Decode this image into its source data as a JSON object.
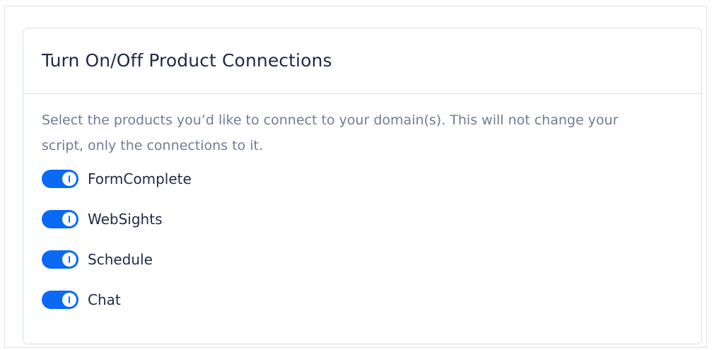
{
  "panel": {
    "title": "Turn On/Off Product Connections",
    "description": "Select the products you’d like to connect to your domain(s). This will not change your script, only the connections to it."
  },
  "products": [
    {
      "label": "FormComplete",
      "enabled": true
    },
    {
      "label": "WebSights",
      "enabled": true
    },
    {
      "label": "Schedule",
      "enabled": true
    },
    {
      "label": "Chat",
      "enabled": true
    }
  ],
  "colors": {
    "accent": "#0a69f5",
    "title_text": "#1f2a44",
    "body_text": "#6f7d93",
    "border": "#d2e0f3"
  }
}
